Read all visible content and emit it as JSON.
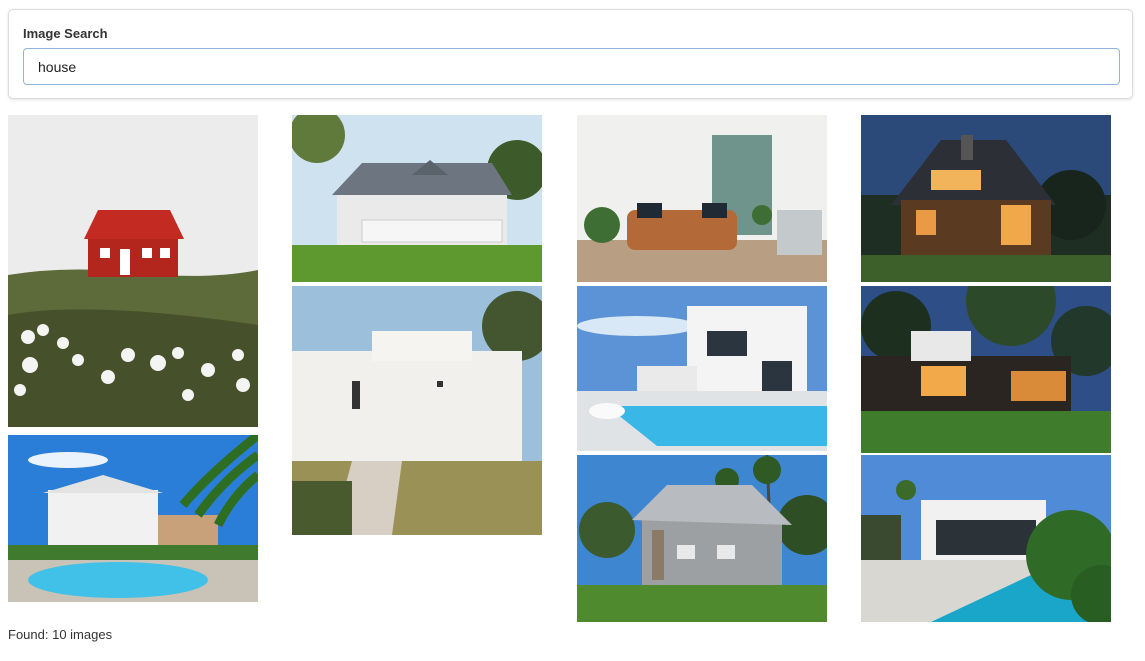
{
  "search": {
    "label": "Image Search",
    "value": "house"
  },
  "results": {
    "status": "Found: 10 images",
    "images": [
      {
        "subject": "red cabin on grassy hill with white flowers"
      },
      {
        "subject": "white modern villa with pool and palm tree"
      },
      {
        "subject": "grey shingle farmhouse with porch"
      },
      {
        "subject": "white cubic stucco house with path"
      },
      {
        "subject": "living room with tan leather sofa"
      },
      {
        "subject": "white modern house with swimming pool"
      },
      {
        "subject": "grey craftsman house with palm trees"
      },
      {
        "subject": "wooden A-frame house lit at dusk"
      },
      {
        "subject": "dark modern house with lit windows and tree"
      },
      {
        "subject": "white modern house with pool and tropical plants"
      }
    ]
  }
}
